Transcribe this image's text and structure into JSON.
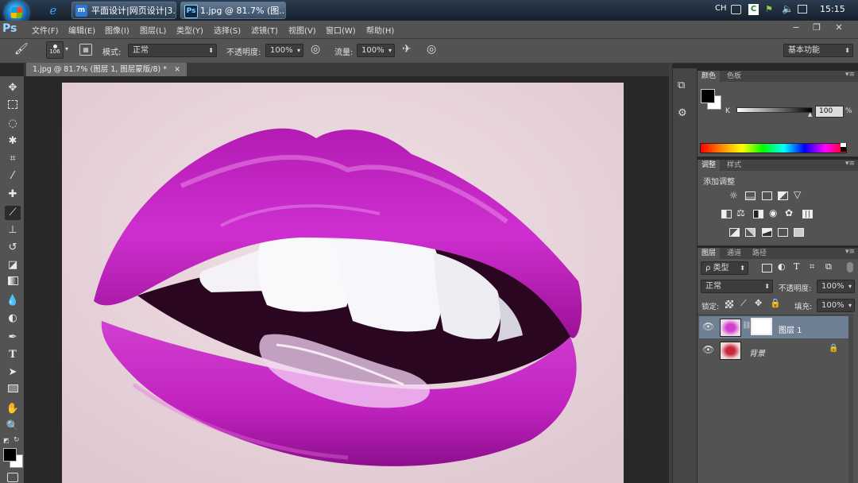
{
  "taskbar": {
    "tasks": [
      {
        "label": "平面设计|网页设计|3..."
      },
      {
        "label": "1.jpg @ 81.7% (图..."
      }
    ],
    "tray": {
      "lang": "CH",
      "time": "15:15"
    }
  },
  "menubar": {
    "logo": "Ps",
    "items": [
      "文件(F)",
      "编辑(E)",
      "图像(I)",
      "图层(L)",
      "类型(Y)",
      "选择(S)",
      "滤镜(T)",
      "视图(V)",
      "窗口(W)",
      "帮助(H)"
    ],
    "window_buttons": {
      "minimize": "−",
      "restore": "❐",
      "close": "✕"
    }
  },
  "options": {
    "brush_size": "106",
    "mode_label": "模式:",
    "mode_value": "正常",
    "opacity_label": "不透明度:",
    "opacity_value": "100%",
    "flow_label": "流量:",
    "flow_value": "100%",
    "workspace": "基本功能"
  },
  "document": {
    "tab_title": "1.jpg @ 81.7% (图层 1, 图层蒙版/8) *",
    "close": "×"
  },
  "tools": [
    "move-icon",
    "marquee-icon",
    "lasso-icon",
    "magic-wand-icon",
    "crop-icon",
    "eyedropper-icon",
    "healing-icon",
    "brush-icon",
    "stamp-icon",
    "history-brush-icon",
    "eraser-icon",
    "gradient-icon",
    "blur-icon",
    "dodge-icon",
    "pen-icon",
    "type-icon",
    "path-select-icon",
    "shape-icon",
    "hand-icon",
    "zoom-icon"
  ],
  "color_panel": {
    "tabs": [
      "颜色",
      "色板"
    ],
    "channel_label": "K",
    "value": "100",
    "unit": "%",
    "foreground": "#000000",
    "background": "#ffffff"
  },
  "adjustments_panel": {
    "tabs": [
      "调整",
      "样式"
    ],
    "title": "添加调整"
  },
  "layers_panel": {
    "tabs": [
      "图层",
      "通道",
      "路径"
    ],
    "filter_label": "ρ 类型",
    "blend_mode": "正常",
    "opacity_label": "不透明度:",
    "opacity_value": "100%",
    "lock_label": "锁定:",
    "fill_label": "填充:",
    "fill_value": "100%",
    "layers": [
      {
        "name": "图层 1",
        "selected": true
      },
      {
        "name": "背景",
        "selected": false
      }
    ]
  },
  "colors": {
    "accent": "#c21fc8",
    "panel_bg": "#535353",
    "selected_layer": "#6f7f94"
  }
}
